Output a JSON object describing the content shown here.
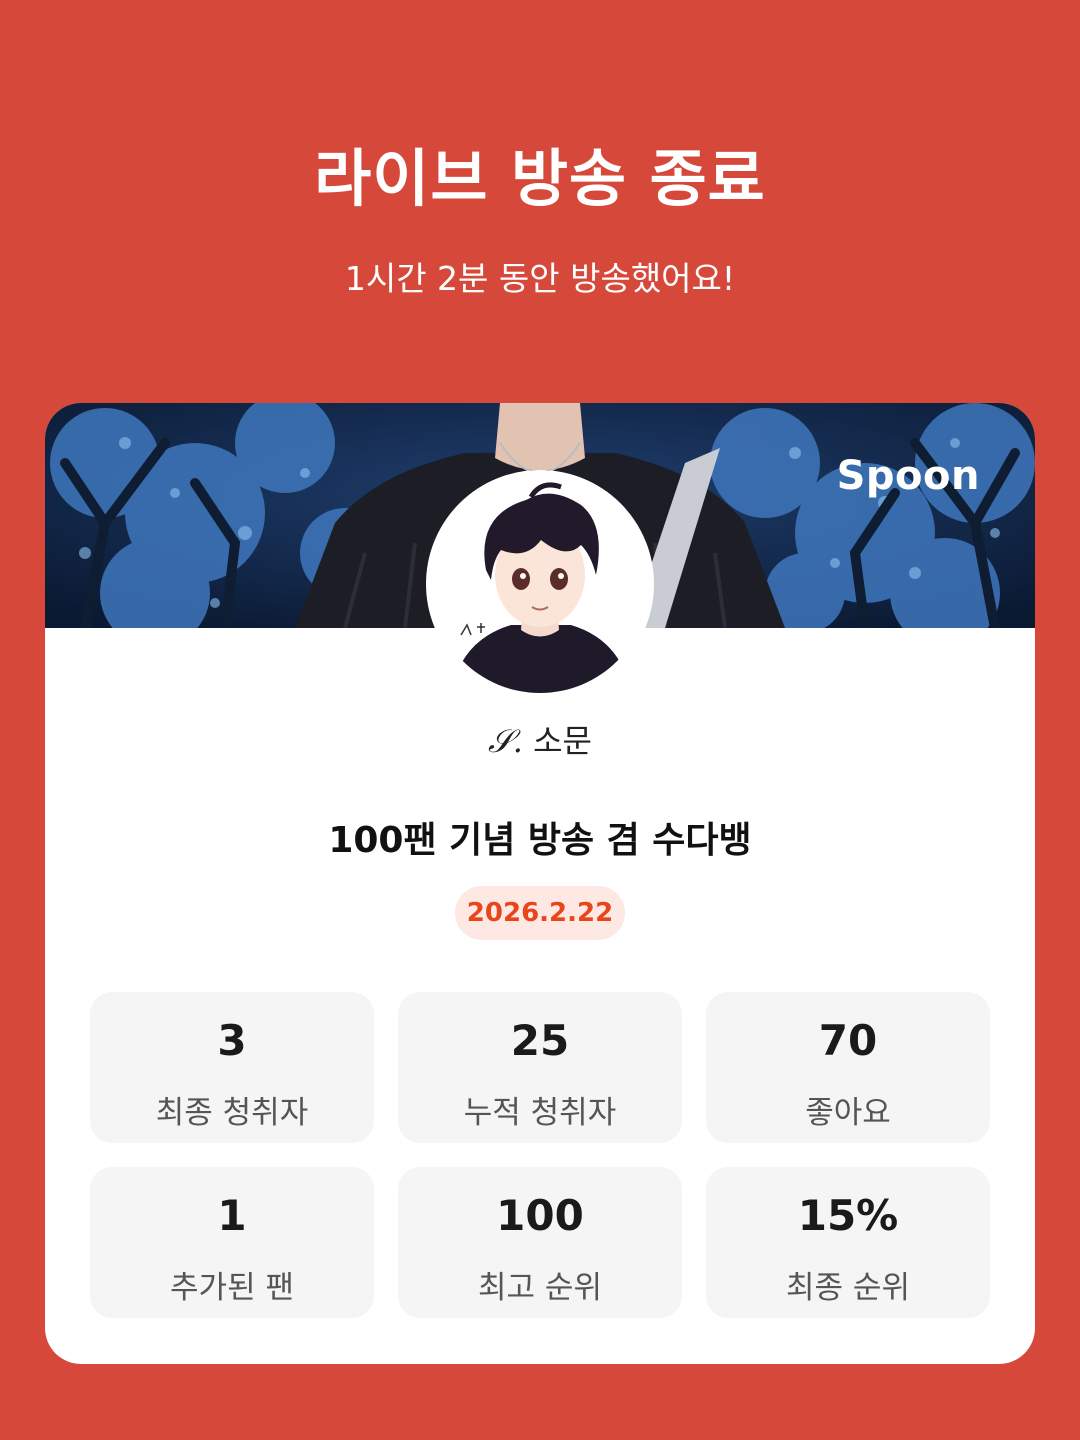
{
  "header": {
    "title": "라이브 방송 종료",
    "subtitle": "1시간 2분 동안 방송했어요!"
  },
  "card": {
    "brand": "Spoon",
    "username_prefix": "𝒮.",
    "username": "소문",
    "stream_title": "100팬 기념 방송 겸 수다뱅",
    "date": "2026.2.22"
  },
  "stats": [
    {
      "value": "3",
      "label": "최종 청취자"
    },
    {
      "value": "25",
      "label": "누적 청취자"
    },
    {
      "value": "70",
      "label": "좋아요"
    },
    {
      "value": "1",
      "label": "추가된 팬"
    },
    {
      "value": "100",
      "label": "최고 순위"
    },
    {
      "value": "15%",
      "label": "최종 순위"
    }
  ],
  "colors": {
    "background": "#d6483a",
    "badge_bg": "#fde8e3",
    "badge_text": "#e8451b"
  }
}
